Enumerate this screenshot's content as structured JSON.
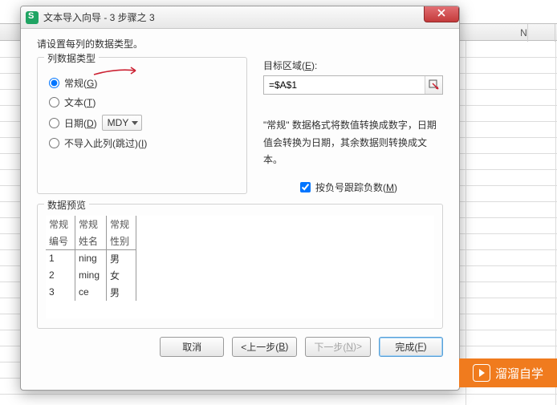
{
  "dialog": {
    "title": "文本导入向导 - 3 步骤之 3",
    "intro": "请设置每列的数据类型。",
    "column_type": {
      "legend": "列数据类型",
      "selected": "general",
      "general": {
        "label_pre": "常规(",
        "key": "G",
        "label_post": ")"
      },
      "text": {
        "label_pre": "文本(",
        "key": "T",
        "label_post": ")"
      },
      "date": {
        "label_pre": "日期(",
        "key": "D",
        "label_post": ")",
        "format": "MDY"
      },
      "skip": {
        "label_pre": "不导入此列(跳过)(",
        "key": "I",
        "label_post": ")"
      }
    },
    "target": {
      "label_pre": "目标区域(",
      "key": "E",
      "label_post": "):",
      "value": "=$A$1"
    },
    "note": "\"常规\" 数据格式将数值转换成数字，日期值会转换为日期，其余数据则转换成文本。",
    "negatives": {
      "label_pre": "按负号跟踪负数(",
      "key": "M",
      "label_post": ")",
      "checked": true
    },
    "preview": {
      "legend": "数据预览",
      "column_types": [
        "常规",
        "常规",
        "常规"
      ],
      "headers": [
        "编号",
        "姓名",
        "性别"
      ],
      "rows": [
        [
          "1",
          "ning",
          "男"
        ],
        [
          "2",
          "ming",
          "女"
        ],
        [
          "3",
          "ce",
          "男"
        ]
      ]
    },
    "buttons": {
      "cancel": "取消",
      "prev_pre": "<上一步(",
      "prev_key": "B",
      "prev_post": ")",
      "next_pre": "下一步(",
      "next_key": "N",
      "next_post": ")>",
      "finish_pre": "完成(",
      "finish_key": "F",
      "finish_post": ")"
    }
  },
  "spreadsheet": {
    "visible_column": "N"
  },
  "brand": {
    "text": "溜溜自学",
    "url": "www.zixue.3d66.com"
  }
}
